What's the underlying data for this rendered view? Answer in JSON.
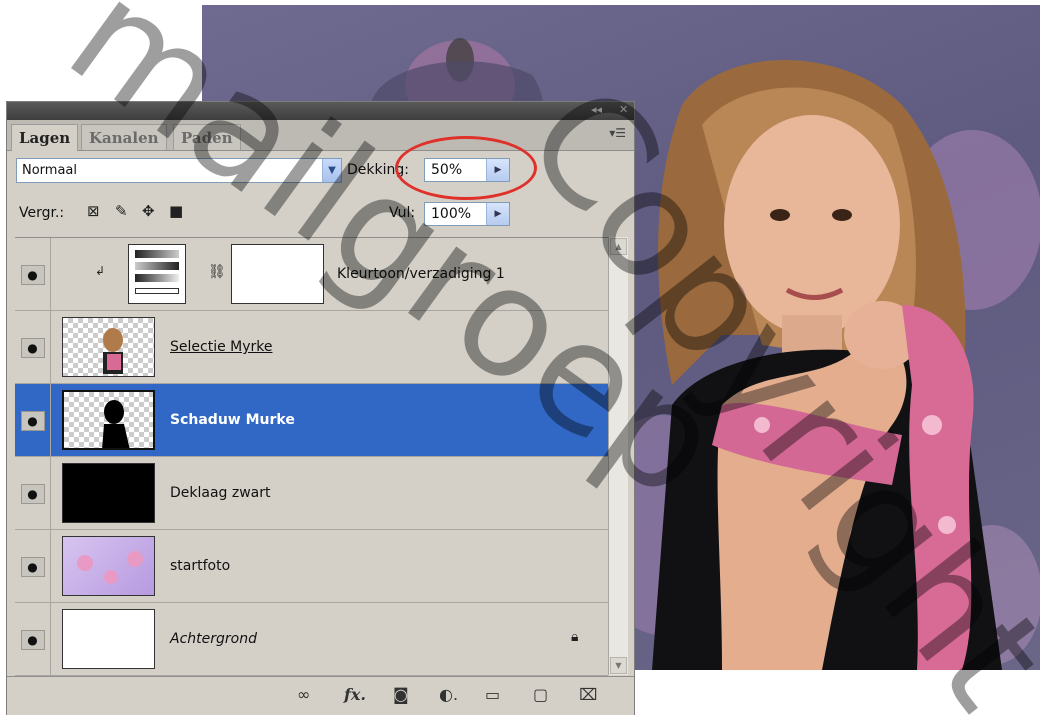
{
  "panel": {
    "title_controls": [
      "◂◂",
      "✕"
    ],
    "tabs": [
      {
        "label": "Lagen",
        "active": true
      },
      {
        "label": "Kanalen",
        "active": false
      },
      {
        "label": "Paden",
        "active": false
      }
    ],
    "menu_icon": "panel-menu-icon"
  },
  "blend": {
    "mode": "Normaal",
    "opacity_label": "Dekking:",
    "opacity_value": "50%",
    "lock_label": "Vergr.:",
    "fill_label": "Vul:",
    "fill_value": "100%"
  },
  "layers": [
    {
      "name": "Kleurtoon/verzadiging 1",
      "type": "adjustment",
      "visible": true,
      "selected": false,
      "style": "normal"
    },
    {
      "name": "Selectie Myrke",
      "type": "pixel",
      "visible": true,
      "selected": false,
      "style": "underline"
    },
    {
      "name": "Schaduw Murke",
      "type": "pixel",
      "visible": true,
      "selected": true,
      "style": "bold"
    },
    {
      "name": "Deklaag zwart",
      "type": "fill",
      "visible": true,
      "selected": false,
      "style": "normal"
    },
    {
      "name": "startfoto",
      "type": "pixel",
      "visible": true,
      "selected": false,
      "style": "normal"
    },
    {
      "name": "Achtergrond",
      "type": "background",
      "visible": true,
      "selected": false,
      "style": "italic",
      "locked": true
    }
  ],
  "bottom_tools": [
    "link-layers-icon",
    "fx-icon",
    "add-mask-icon",
    "adjustment-layer-icon",
    "new-group-icon",
    "new-layer-icon",
    "trash-icon"
  ],
  "watermark": {
    "text_1": "mailgroep",
    "text_2": "Copyright"
  },
  "colors": {
    "selection": "#3168c6",
    "highlight": "#e0302a",
    "panel": "#d4d0c8"
  }
}
